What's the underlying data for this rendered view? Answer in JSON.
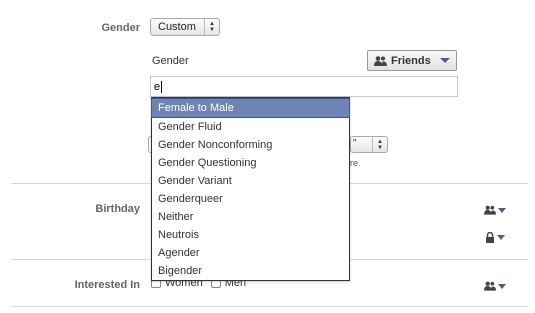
{
  "gender_row": {
    "label": "Gender",
    "select_value": "Custom",
    "sub_label": "Gender",
    "audience_label": "Friends",
    "input_value": "e",
    "suggestions": [
      "Female to Male",
      "Gender Fluid",
      "Gender Nonconforming",
      "Gender Questioning",
      "Gender Variant",
      "Genderqueer",
      "Neither",
      "Neutrois",
      "Agender",
      "Bigender"
    ],
    "highlighted_index": 0,
    "small_select_value": "\"",
    "more_link": "re."
  },
  "birthday_row": {
    "label": "Birthday"
  },
  "interested_row": {
    "label": "Interested In",
    "options": [
      "Women",
      "Men"
    ]
  },
  "colors": {
    "accent": "#3b5998",
    "highlight": "#6d84b4",
    "icon": "#4a5f8a"
  }
}
